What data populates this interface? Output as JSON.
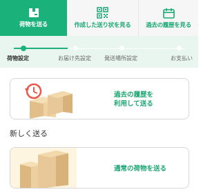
{
  "tabs": [
    {
      "label": "荷物を送る",
      "icon": "box-icon",
      "active": true
    },
    {
      "label": "作成した送り状を見る",
      "icon": "qr-code-icon",
      "active": false
    },
    {
      "label": "過去の履歴を見る",
      "icon": "calendar-icon",
      "active": false
    }
  ],
  "steps": [
    {
      "label": "荷物設定",
      "active": true
    },
    {
      "label": "お届け先設定",
      "active": false
    },
    {
      "label": "発送場所設定",
      "active": false
    },
    {
      "label": "お支払い",
      "active": false
    }
  ],
  "history_card": {
    "line1": "過去の履歴を",
    "line2": "利用して送る"
  },
  "section_title": "新しく送る",
  "regular_card": {
    "label": "通常の荷物を送る"
  },
  "colors": {
    "accent": "#1bb17b",
    "stepper_bg": "#e9f5ef",
    "history_icon": "#e8574a",
    "box": "#e8c898"
  }
}
